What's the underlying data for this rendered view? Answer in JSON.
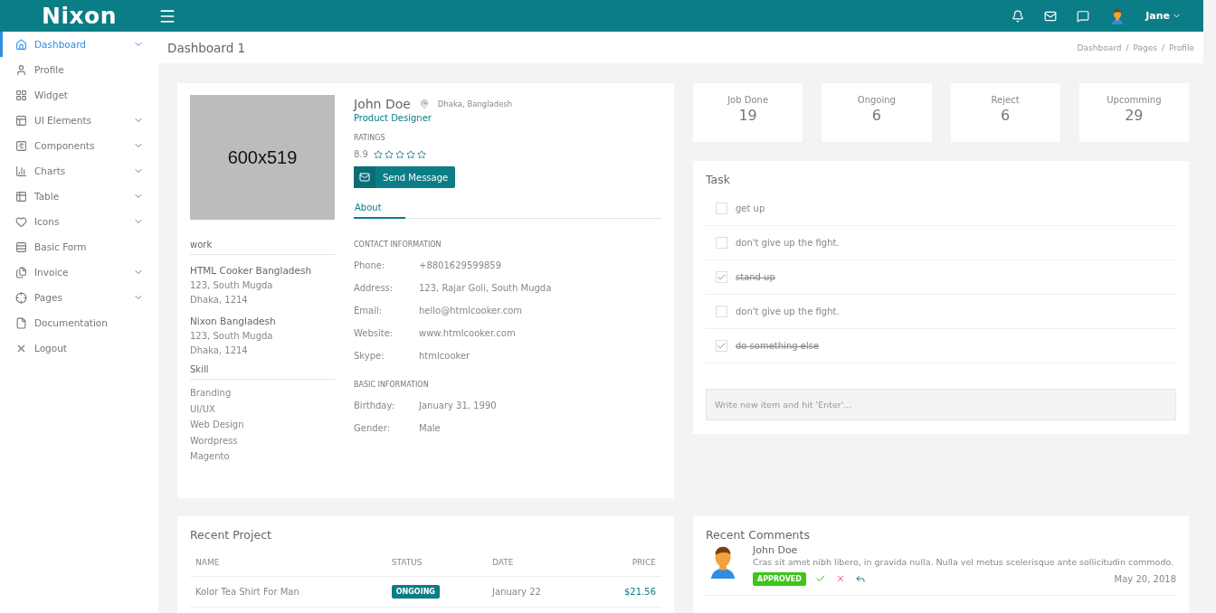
{
  "header": {
    "logo": "Nixon",
    "user": "Jane"
  },
  "sidebar": {
    "items": [
      {
        "label": "Dashboard",
        "selected": true,
        "has_submenu": true
      },
      {
        "label": "Profile",
        "selected": false,
        "has_submenu": false
      },
      {
        "label": "Widget",
        "selected": false,
        "has_submenu": false
      },
      {
        "label": "UI Elements",
        "selected": false,
        "has_submenu": true
      },
      {
        "label": "Components",
        "selected": false,
        "has_submenu": true
      },
      {
        "label": "Charts",
        "selected": false,
        "has_submenu": true
      },
      {
        "label": "Table",
        "selected": false,
        "has_submenu": true
      },
      {
        "label": "Icons",
        "selected": false,
        "has_submenu": true
      },
      {
        "label": "Basic Form",
        "selected": false,
        "has_submenu": false
      },
      {
        "label": "Invoice",
        "selected": false,
        "has_submenu": true
      },
      {
        "label": "Pages",
        "selected": false,
        "has_submenu": true
      },
      {
        "label": "Documentation",
        "selected": false,
        "has_submenu": false
      },
      {
        "label": "Logout",
        "selected": false,
        "has_submenu": false
      }
    ]
  },
  "page": {
    "title": "Dashboard 1",
    "breadcrumb_separator": "/",
    "breadcrumb": [
      "Dashboard",
      "Pages",
      "Profile"
    ]
  },
  "profile": {
    "image_label": "600x519",
    "name": "John Doe",
    "location": "Dhaka, Bangladesh",
    "role": "Product Designer",
    "ratings_label": "RATINGS",
    "rating": "8.9",
    "stars": 0,
    "button": "Send Message",
    "tabs": [
      {
        "label": "About",
        "selected": true
      }
    ],
    "work_heading": "work",
    "work": [
      {
        "name": "HTML Cooker Bangladesh",
        "lines": [
          "123, South Mugda",
          "Dhaka, 1214"
        ]
      },
      {
        "name": "Nixon Bangladesh",
        "lines": [
          "123, South Mugda",
          "Dhaka, 1214"
        ]
      }
    ],
    "skill_heading": "Skill",
    "skills": [
      "Branding",
      "UI/UX",
      "Web Design",
      "Wordpress",
      "Magento"
    ],
    "contact_heading": "CONTACT INFORMATION",
    "contact": [
      {
        "label": "Phone:",
        "value": "+8801629599859"
      },
      {
        "label": "Address:",
        "value": "123, Rajar Goli, South Mugda"
      },
      {
        "label": "Email:",
        "value": "hello@htmlcooker.com"
      },
      {
        "label": "Website:",
        "value": "www.htmlcooker.com"
      },
      {
        "label": "Skype:",
        "value": "htmlcooker"
      }
    ],
    "basic_heading": "BASIC INFORMATION",
    "basic": [
      {
        "label": "Birthday:",
        "value": "January 31, 1990"
      },
      {
        "label": "Gender:",
        "value": "Male"
      }
    ]
  },
  "stats": [
    {
      "label": "Job Done",
      "value": "19"
    },
    {
      "label": "Ongoing",
      "value": "6"
    },
    {
      "label": "Reject",
      "value": "6"
    },
    {
      "label": "Upcomming",
      "value": "29"
    }
  ],
  "task": {
    "title": "Task",
    "items": [
      {
        "label": "get up",
        "checked": false
      },
      {
        "label": "don't give up the fight.",
        "checked": false
      },
      {
        "label": "stand up",
        "checked": true
      },
      {
        "label": "don't give up the fight.",
        "checked": false
      },
      {
        "label": "do something else",
        "checked": true
      }
    ],
    "placeholder": "Write new item and hit 'Enter'..."
  },
  "recent_project": {
    "title": "Recent Project",
    "columns": [
      "NAME",
      "STATUS",
      "DATE",
      "PRICE"
    ],
    "rows": [
      {
        "name": "Kolor Tea Shirt For Man",
        "status": "ONGOING",
        "color": "#0b7d86",
        "date": "January 22",
        "price": "$21.56"
      }
    ]
  },
  "recent_comments": {
    "title": "Recent Comments",
    "items": [
      {
        "name": "John Doe",
        "text": "Cras sit amet nibh libero, in gravida nulla. Nulla vel metus scelerisque ante sollicitudin commodo.",
        "status": "APPROVED",
        "color": "#3cc618",
        "date": "May 20, 2018"
      }
    ]
  }
}
